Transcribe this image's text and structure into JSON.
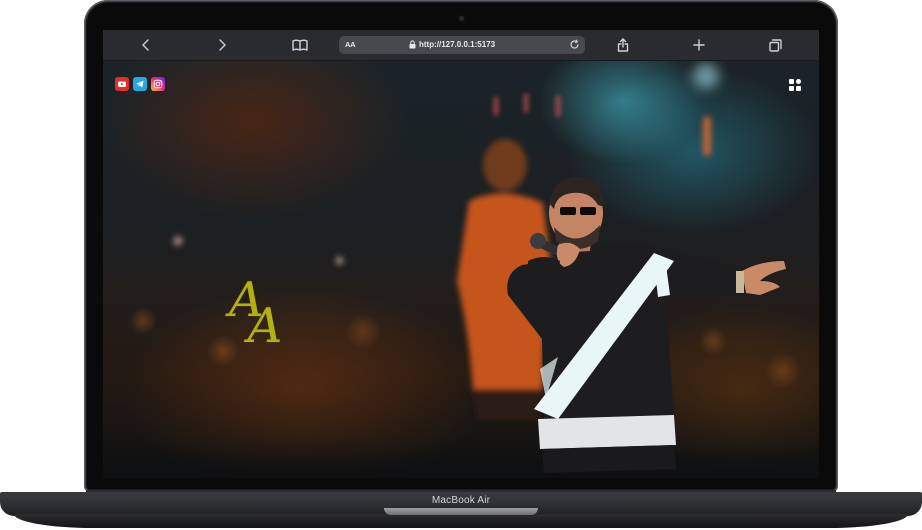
{
  "device": {
    "model_label": "MacBook Air"
  },
  "browser": {
    "text_size_label": "AA",
    "url": "http://127.0.0.1:5173",
    "icons": {
      "back": "chevron-left-icon",
      "forward": "chevron-right-icon",
      "reader": "book-icon",
      "lock": "lock-icon",
      "reload": "reload-icon",
      "share": "share-icon",
      "new_tab": "plus-icon",
      "tabs": "tabs-icon"
    }
  },
  "page": {
    "social_links": [
      {
        "icon": "youtube-icon",
        "color": "#e52d27"
      },
      {
        "icon": "telegram-icon",
        "color": "#2aa7e0"
      },
      {
        "icon": "instagram-icon",
        "color": "#ee2a7b"
      }
    ],
    "menu_icon": "grid-menu-icon",
    "logo_text": "AA",
    "logo_color": "#b3b013"
  }
}
